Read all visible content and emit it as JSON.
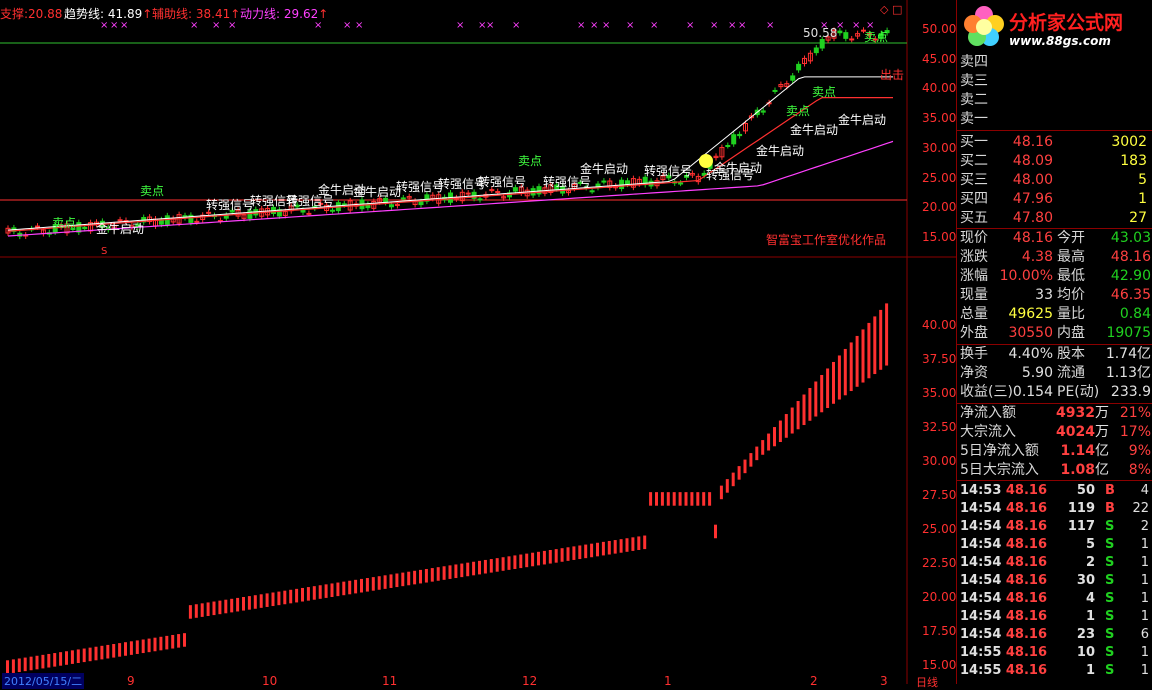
{
  "indicator_header": [
    {
      "label": "支撑:",
      "value": "20.88",
      "color": "#ff3030",
      "arrow": ""
    },
    {
      "label": "趋势线:",
      "value": "41.89",
      "color": "#ffffff",
      "arrow": "↑"
    },
    {
      "label": "辅助线:",
      "value": "38.41",
      "color": "#ff3030",
      "arrow": "↑"
    },
    {
      "label": "动力线:",
      "value": "29.62",
      "color": "#ff40ff",
      "arrow": "↑"
    }
  ],
  "window_icons": [
    "◇",
    "□"
  ],
  "price_axis_top": [
    "50.00",
    "45.00",
    "40.00",
    "35.00",
    "30.00",
    "25.00",
    "20.00",
    "15.00"
  ],
  "price_axis_bottom": [
    "40.00",
    "37.50",
    "35.00",
    "32.50",
    "30.00",
    "27.50",
    "25.00",
    "22.50",
    "20.00",
    "17.50",
    "15.00"
  ],
  "annotations": {
    "high_label": "50.58",
    "watermark": "智富宝工作室优化作品",
    "date_label": "2012/05/15/二",
    "s_marker": "S",
    "day_label": "日线",
    "x_ticks": [
      "9",
      "10",
      "11",
      "12",
      "1",
      "2",
      "3"
    ],
    "signals": [
      {
        "text": "卖点",
        "color": "#40ff40"
      },
      {
        "text": "金牛启动",
        "color": "#ffffff"
      },
      {
        "text": "转强信号",
        "color": "#ffffff"
      },
      {
        "text": "卖点",
        "color": "#40ff40"
      },
      {
        "text": "金牛启动",
        "color": "#ffffff"
      },
      {
        "text": "转强信号",
        "color": "#ffffff"
      },
      {
        "text": "转强信号",
        "color": "#ffffff"
      },
      {
        "text": "转强信号",
        "color": "#ffffff"
      },
      {
        "text": "金牛启动",
        "color": "#ffffff"
      },
      {
        "text": "转强信号",
        "color": "#ffffff"
      },
      {
        "text": "转强信号",
        "color": "#ffffff"
      },
      {
        "text": "卖点",
        "color": "#40ff40"
      },
      {
        "text": "转强信号",
        "color": "#ffffff"
      },
      {
        "text": "金牛启动",
        "color": "#ffffff"
      },
      {
        "text": "转强信号",
        "color": "#ffffff"
      },
      {
        "text": "转强信号",
        "color": "#ffffff"
      },
      {
        "text": "金牛启动",
        "color": "#ffffff"
      },
      {
        "text": "金牛启动",
        "color": "#ffffff"
      },
      {
        "text": "卖点",
        "color": "#40ff40"
      },
      {
        "text": "金牛启动",
        "color": "#ffffff"
      },
      {
        "text": "金牛启动",
        "color": "#ffffff"
      },
      {
        "text": "卖点",
        "color": "#40ff40"
      },
      {
        "text": "卖点",
        "color": "#40ff40"
      },
      {
        "text": "出击",
        "color": "#ff3030"
      }
    ]
  },
  "logo": {
    "title": "分析家公式网",
    "url": "www.88gs.com"
  },
  "order_book": {
    "sell": [
      {
        "label": "卖四",
        "price": "",
        "vol": ""
      },
      {
        "label": "卖三",
        "price": "",
        "vol": ""
      },
      {
        "label": "卖二",
        "price": "",
        "vol": ""
      },
      {
        "label": "卖一",
        "price": "",
        "vol": ""
      }
    ],
    "buy": [
      {
        "label": "买一",
        "price": "48.16",
        "vol": "3002"
      },
      {
        "label": "买二",
        "price": "48.09",
        "vol": "183"
      },
      {
        "label": "买三",
        "price": "48.00",
        "vol": "5"
      },
      {
        "label": "买四",
        "price": "47.96",
        "vol": "1"
      },
      {
        "label": "买五",
        "price": "47.80",
        "vol": "27"
      }
    ]
  },
  "quote": [
    {
      "l1": "现价",
      "v1": "48.16",
      "c1": "red",
      "l2": "今开",
      "v2": "43.03",
      "c2": "grn"
    },
    {
      "l1": "涨跌",
      "v1": "4.38",
      "c1": "red",
      "l2": "最高",
      "v2": "48.16",
      "c2": "red"
    },
    {
      "l1": "涨幅",
      "v1": "10.00%",
      "c1": "red",
      "l2": "最低",
      "v2": "42.90",
      "c2": "grn"
    },
    {
      "l1": "现量",
      "v1": "33",
      "c1": "wht",
      "l2": "均价",
      "v2": "46.35",
      "c2": "red"
    },
    {
      "l1": "总量",
      "v1": "49625",
      "c1": "yel",
      "l2": "量比",
      "v2": "0.84",
      "c2": "grn"
    },
    {
      "l1": "外盘",
      "v1": "30550",
      "c1": "red",
      "l2": "内盘",
      "v2": "19075",
      "c2": "grn"
    }
  ],
  "fundamentals": [
    {
      "l1": "换手",
      "v1": "4.40%",
      "c1": "wht",
      "l2": "股本",
      "v2": "1.74亿",
      "c2": "wht"
    },
    {
      "l1": "净资",
      "v1": "5.90",
      "c1": "wht",
      "l2": "流通",
      "v2": "1.13亿",
      "c2": "wht"
    },
    {
      "l1": "收益(三)",
      "v1": "0.154",
      "c1": "wht",
      "l2": "PE(动)",
      "v2": "233.9",
      "c2": "wht"
    }
  ],
  "fund_flow": [
    {
      "label": "净流入额",
      "value": "4932",
      "unit": "万",
      "pct": "21%"
    },
    {
      "label": "大宗流入",
      "value": "4024",
      "unit": "万",
      "pct": "17%"
    },
    {
      "label": "5日净流入额",
      "value": "1.14",
      "unit": "亿",
      "pct": "9%"
    },
    {
      "label": "5日大宗流入",
      "value": "1.08",
      "unit": "亿",
      "pct": "8%"
    }
  ],
  "ticks": [
    {
      "time": "14:53",
      "price": "48.16",
      "vol": "50",
      "bs": "B",
      "n": "4"
    },
    {
      "time": "14:54",
      "price": "48.16",
      "vol": "119",
      "bs": "B",
      "n": "22"
    },
    {
      "time": "14:54",
      "price": "48.16",
      "vol": "117",
      "bs": "S",
      "n": "2"
    },
    {
      "time": "14:54",
      "price": "48.16",
      "vol": "5",
      "bs": "S",
      "n": "1"
    },
    {
      "time": "14:54",
      "price": "48.16",
      "vol": "2",
      "bs": "S",
      "n": "1"
    },
    {
      "time": "14:54",
      "price": "48.16",
      "vol": "30",
      "bs": "S",
      "n": "1"
    },
    {
      "time": "14:54",
      "price": "48.16",
      "vol": "4",
      "bs": "S",
      "n": "1"
    },
    {
      "time": "14:54",
      "price": "48.16",
      "vol": "1",
      "bs": "S",
      "n": "1"
    },
    {
      "time": "14:54",
      "price": "48.16",
      "vol": "23",
      "bs": "S",
      "n": "6"
    },
    {
      "time": "14:55",
      "price": "48.16",
      "vol": "10",
      "bs": "S",
      "n": "1"
    },
    {
      "time": "14:55",
      "price": "48.16",
      "vol": "1",
      "bs": "S",
      "n": "1"
    }
  ],
  "colors": {
    "up": "#ff3030",
    "down": "#20d020",
    "border": "#8b0000",
    "magenta": "#ff40ff"
  }
}
